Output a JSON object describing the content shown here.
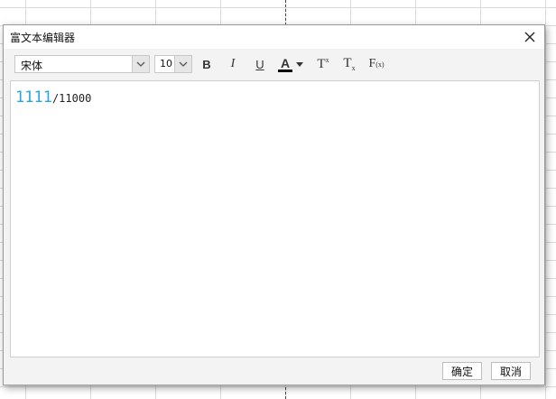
{
  "dialog": {
    "title": "富文本编辑器"
  },
  "toolbar": {
    "font_value": "宋体",
    "size_value": "10",
    "bold_label": "B",
    "italic_label": "I",
    "underline_label": "U",
    "color_label": "A",
    "font_color": "#000000",
    "superscript_label": "T",
    "superscript_mark": "x",
    "subscript_label": "T",
    "subscript_mark": "x",
    "formula_label": "F",
    "formula_mark": "(x)"
  },
  "editor": {
    "number_text": "1111",
    "number_color": "#2aa6da",
    "rest_text": "/11000"
  },
  "buttons": {
    "ok_label": "确定",
    "cancel_label": "取消"
  }
}
